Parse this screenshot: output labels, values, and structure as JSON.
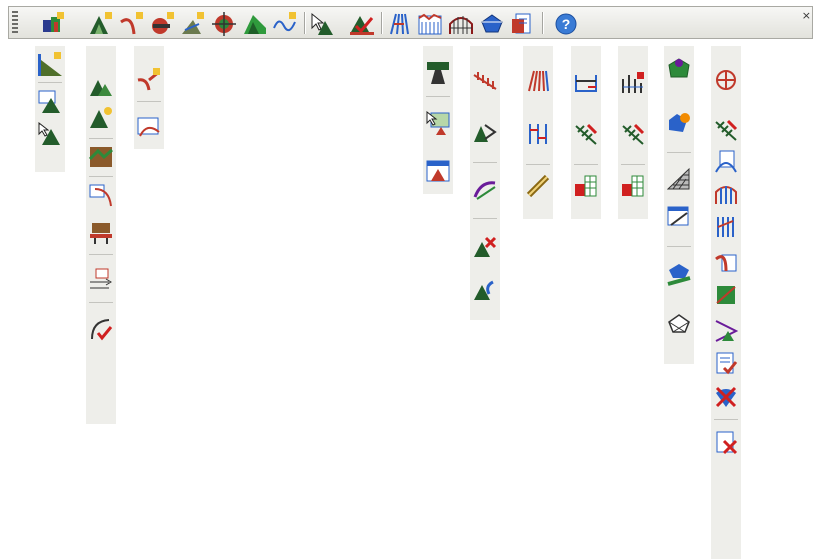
{
  "toolbar": {
    "items": [
      {
        "icon": "terrain-grid-icon"
      },
      {
        "icon": "surface-add-icon"
      },
      {
        "icon": "alignment-curve-icon"
      },
      {
        "icon": "profile-red-icon"
      },
      {
        "icon": "terrain-add-icon"
      },
      {
        "icon": "target-gear-icon"
      },
      {
        "icon": "green-terrain-icon"
      },
      {
        "icon": "wave-line-icon"
      },
      {
        "icon": "cursor-terrain-icon"
      },
      {
        "icon": "terrain-check-icon"
      },
      {
        "icon": "road-lines-icon"
      },
      {
        "icon": "blue-profile-icon"
      },
      {
        "icon": "bridge-grid-icon"
      },
      {
        "icon": "blue-solid-icon"
      },
      {
        "icon": "document-stack-icon"
      },
      {
        "icon": "help-icon"
      }
    ]
  }
}
